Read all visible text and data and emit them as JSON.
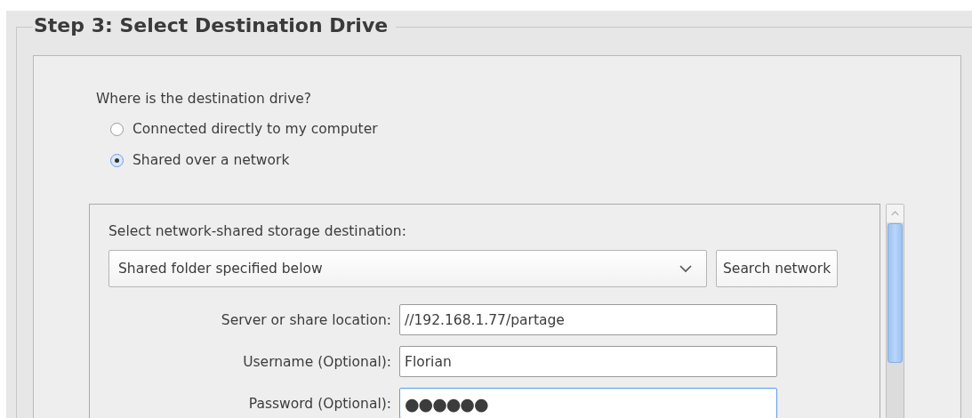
{
  "group": {
    "title": "Step 3: Select Destination Drive"
  },
  "question": "Where is the destination drive?",
  "options": [
    {
      "label": "Connected directly to my computer",
      "selected": false
    },
    {
      "label": "Shared over a network",
      "selected": true
    }
  ],
  "network": {
    "label": "Select network-shared storage destination:",
    "dropdown": {
      "value": "Shared folder specified below"
    },
    "search_button": "Search network",
    "fields": [
      {
        "label": "Server or share location:",
        "value": "//192.168.1.77/partage",
        "focused": false
      },
      {
        "label": "Username (Optional):",
        "value": "Florian",
        "focused": false
      },
      {
        "label": "Password (Optional):",
        "value": "●●●●●●",
        "focused": true
      }
    ]
  }
}
